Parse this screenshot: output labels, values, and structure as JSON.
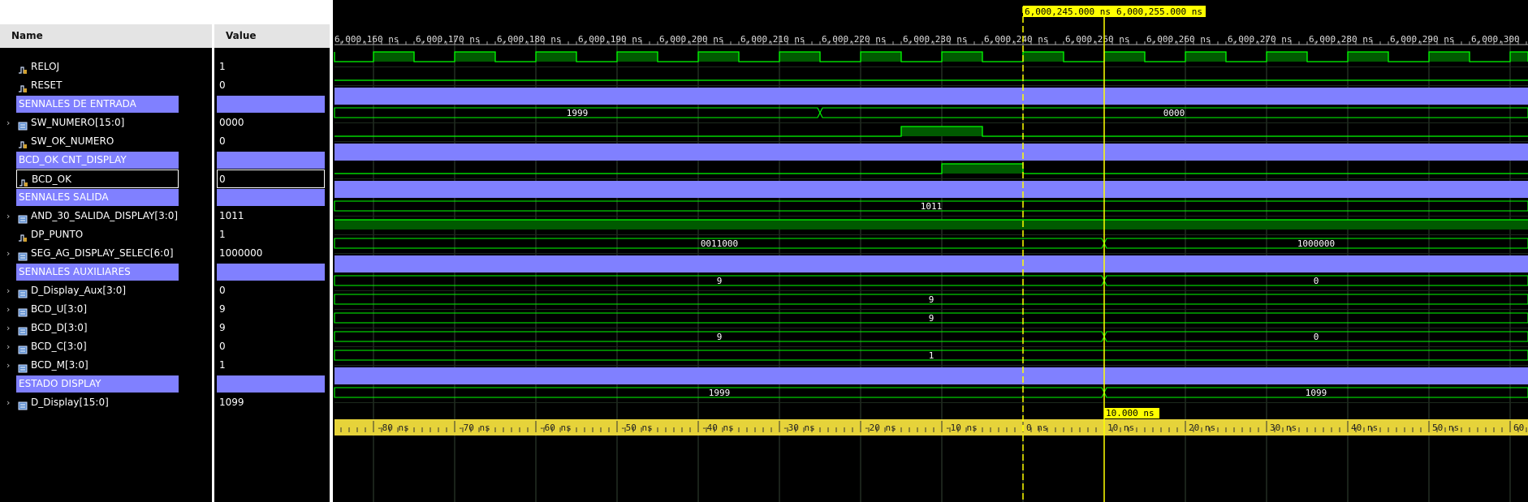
{
  "columns": {
    "name": "Name",
    "value": "Value"
  },
  "signals": [
    {
      "name": "RELOJ",
      "value": "1",
      "kind": "bit",
      "expandable": false
    },
    {
      "name": "RESET",
      "value": "0",
      "kind": "bit",
      "expandable": false
    },
    {
      "name": "SENNALES DE ENTRADA",
      "value": "",
      "kind": "divider",
      "expandable": false
    },
    {
      "name": "SW_NUMERO[15:0]",
      "value": "0000",
      "kind": "bus",
      "expandable": true
    },
    {
      "name": "SW_OK_NUMERO",
      "value": "0",
      "kind": "bit",
      "expandable": false
    },
    {
      "name": "BCD_OK CNT_DISPLAY",
      "value": "",
      "kind": "divider",
      "expandable": false
    },
    {
      "name": "BCD_OK",
      "value": "0",
      "kind": "bit-selected",
      "expandable": false
    },
    {
      "name": "SENNALES SALIDA",
      "value": "",
      "kind": "divider",
      "expandable": false
    },
    {
      "name": "AND_30_SALIDA_DISPLAY[3:0]",
      "value": "1011",
      "kind": "bus",
      "expandable": true
    },
    {
      "name": "DP_PUNTO",
      "value": "1",
      "kind": "bit",
      "expandable": false
    },
    {
      "name": "SEG_AG_DISPLAY_SELEC[6:0]",
      "value": "1000000",
      "kind": "bus",
      "expandable": true
    },
    {
      "name": "SENNALES AUXILIARES",
      "value": "",
      "kind": "divider",
      "expandable": false
    },
    {
      "name": "D_Display_Aux[3:0]",
      "value": "0",
      "kind": "bus",
      "expandable": true
    },
    {
      "name": "BCD_U[3:0]",
      "value": "9",
      "kind": "bus",
      "expandable": true
    },
    {
      "name": "BCD_D[3:0]",
      "value": "9",
      "kind": "bus",
      "expandable": true
    },
    {
      "name": "BCD_C[3:0]",
      "value": "0",
      "kind": "bus",
      "expandable": true
    },
    {
      "name": "BCD_M[3:0]",
      "value": "1",
      "kind": "bus",
      "expandable": true
    },
    {
      "name": "ESTADO DISPLAY",
      "value": "",
      "kind": "divider",
      "expandable": false
    },
    {
      "name": "D_Display[15:0]",
      "value": "1099",
      "kind": "bus",
      "expandable": true
    }
  ],
  "waves": [
    {
      "type": "clock"
    },
    {
      "type": "bit",
      "segments": [
        [
          -100,
          100,
          0
        ]
      ]
    },
    {
      "type": "divider"
    },
    {
      "type": "bus",
      "segments": [
        [
          -100,
          -25,
          "1999"
        ],
        [
          -25,
          100,
          "0000"
        ]
      ]
    },
    {
      "type": "bit",
      "segments": [
        [
          -100,
          -15,
          0
        ],
        [
          -15,
          -5,
          1
        ],
        [
          -5,
          100,
          0
        ]
      ]
    },
    {
      "type": "divider"
    },
    {
      "type": "bit",
      "segments": [
        [
          -100,
          -10,
          0
        ],
        [
          -10,
          0,
          1
        ],
        [
          0,
          100,
          0
        ]
      ]
    },
    {
      "type": "divider"
    },
    {
      "type": "bus",
      "segments": [
        [
          -100,
          100,
          "1011"
        ]
      ]
    },
    {
      "type": "bit",
      "segments": [
        [
          -100,
          100,
          1
        ]
      ]
    },
    {
      "type": "bus",
      "segments": [
        [
          -100,
          10,
          "0011000"
        ],
        [
          10,
          100,
          "1000000"
        ]
      ]
    },
    {
      "type": "divider"
    },
    {
      "type": "bus",
      "segments": [
        [
          -100,
          10,
          "9"
        ],
        [
          10,
          100,
          "0"
        ]
      ]
    },
    {
      "type": "bus",
      "segments": [
        [
          -100,
          100,
          "9"
        ]
      ]
    },
    {
      "type": "bus",
      "segments": [
        [
          -100,
          100,
          "9"
        ]
      ]
    },
    {
      "type": "bus",
      "segments": [
        [
          -100,
          10,
          "9"
        ],
        [
          10,
          100,
          "0"
        ]
      ]
    },
    {
      "type": "bus",
      "segments": [
        [
          -100,
          100,
          "1"
        ]
      ]
    },
    {
      "type": "divider"
    },
    {
      "type": "bus",
      "segments": [
        [
          -100,
          10,
          "1999"
        ],
        [
          10,
          100,
          "1099"
        ]
      ]
    }
  ],
  "timeline": {
    "top_labels": [
      "6,000,160 ns",
      "6,000,170 ns",
      "6,000,180 ns",
      "6,000,190 ns",
      "6,000,200 ns",
      "6,000,210 ns",
      "6,000,220 ns",
      "6,000,230 ns",
      "6,000,240 ns",
      "6,000,250 ns",
      "6,000,260 ns",
      "6,000,270 ns",
      "6,000,280 ns",
      "6,000,290 ns",
      "6,000,300"
    ],
    "top_label_times": [
      -80,
      -70,
      -60,
      -50,
      -40,
      -30,
      -20,
      -10,
      0,
      10,
      20,
      30,
      40,
      50,
      60
    ],
    "bottom_labels": [
      "-80 ns",
      "-70 ns",
      "-60 ns",
      "-50 ns",
      "-40 ns",
      "-30 ns",
      "-20 ns",
      "-10 ns",
      "0 ns",
      "10 ns",
      "20 ns",
      "30 ns",
      "40 ns",
      "50 ns",
      "60"
    ],
    "bottom_label_times": [
      -80,
      -70,
      -60,
      -50,
      -40,
      -30,
      -20,
      -10,
      0,
      10,
      20,
      30,
      40,
      50,
      60
    ],
    "cursor1_time": 0,
    "cursor2_time": 10,
    "cursor1_label": "6,000,245.000 ns",
    "cursor2_label": "6,000,255.000 ns",
    "delta_label": "10.000 ns",
    "clock_period_ns": 10,
    "clock_first_rise": -80
  },
  "colors": {
    "divider": "#8080ff",
    "wave": "#00ff00",
    "wave_fill": "#005a00",
    "cursor": "#ffff00",
    "ruler": "#e6d33a",
    "grid": "#2a3a2a"
  }
}
